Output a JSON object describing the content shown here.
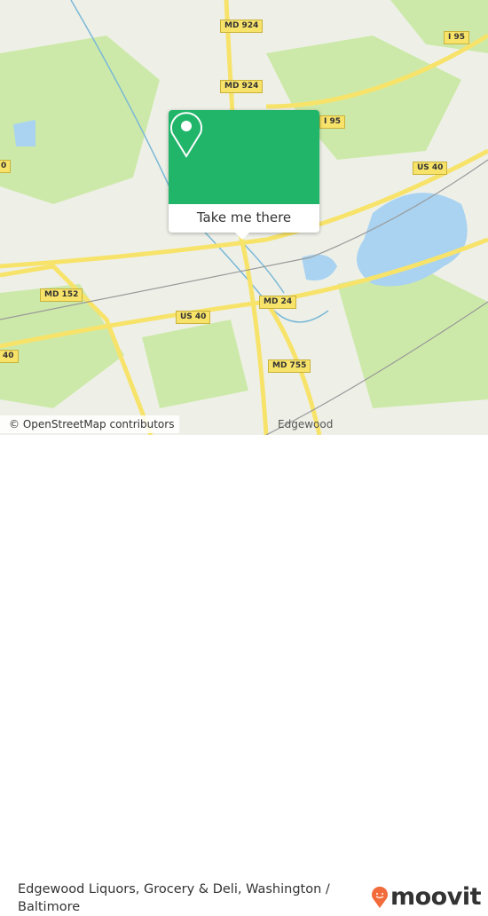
{
  "map": {
    "road_labels": [
      "MD 924",
      "MD 924",
      "I 95",
      "I 95",
      "US 40",
      "MD 152",
      "US 40",
      "MD 24",
      "MD 755",
      "40",
      "0"
    ],
    "place_labels": {
      "edgewood": "Edgewood"
    },
    "attribution": "© OpenStreetMap contributors",
    "colors": {
      "land": "#eef0e8",
      "park": "#cde9a9",
      "water": "#a9d3f0",
      "road": "#f7e36a"
    }
  },
  "popup": {
    "icon": "map-pin-icon",
    "button_label": "Take me there",
    "color": "#21b56a"
  },
  "footer": {
    "title": "Edgewood Liquors, Grocery & Deli, Washington / Baltimore",
    "brand": "moovit",
    "brand_color": "#f26b3a"
  }
}
